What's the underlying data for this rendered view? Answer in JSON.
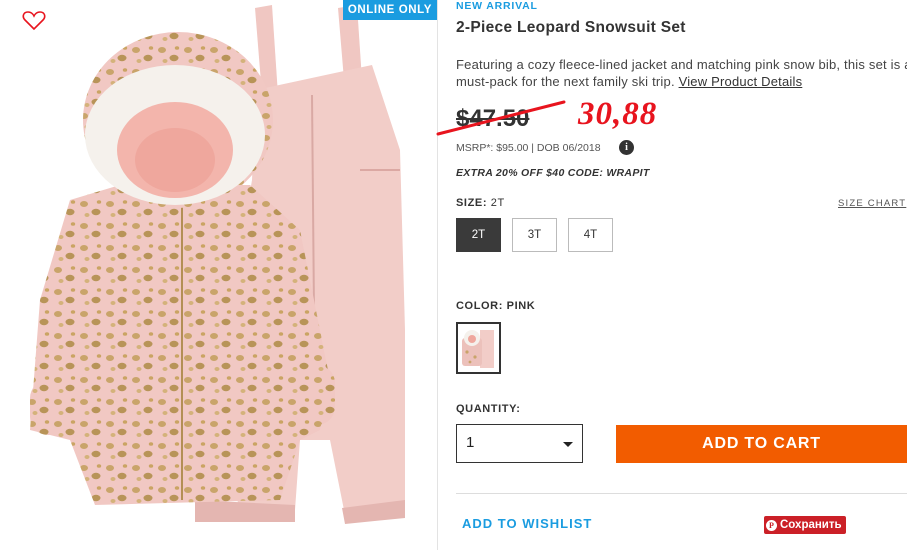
{
  "badge": {
    "online_only": "ONLINE ONLY"
  },
  "product": {
    "tag": "NEW ARRIVAL",
    "title": "2-Piece Leopard Snowsuit Set",
    "description": "Featuring a cozy fleece-lined jacket and matching pink snow bib, this set is a must-pack for the next family ski trip.",
    "details_link": "View Product Details",
    "old_price": "$47.50",
    "handwritten_price": "30,88",
    "msrp": "MSRP*: $95.00 | DOB 06/2018",
    "info_icon_glyph": "i",
    "promo": "EXTRA 20% OFF $40 CODE: WRAPIT"
  },
  "size": {
    "label": "SIZE:",
    "selected": "2T",
    "chart_link": "SIZE CHART",
    "options": [
      "2T",
      "3T",
      "4T"
    ]
  },
  "color": {
    "label": "COLOR: PINK"
  },
  "quantity": {
    "label": "QUANTITY:",
    "value": "1"
  },
  "actions": {
    "add_to_cart": "ADD TO CART",
    "wishlist": "ADD TO WISHLIST",
    "pin_glyph": "P",
    "pin_save": "Сохранить"
  },
  "colors": {
    "accent_blue": "#1a9ce0",
    "cta_orange": "#f25c00",
    "annotation_red": "#e8141e",
    "pinterest_red": "#cb2027",
    "selected_size_bg": "#3a3a3a"
  },
  "icons": {
    "favorite": "heart-outline-icon",
    "info": "info-icon",
    "dropdown": "caret-down-icon",
    "pinterest": "pinterest-icon"
  }
}
